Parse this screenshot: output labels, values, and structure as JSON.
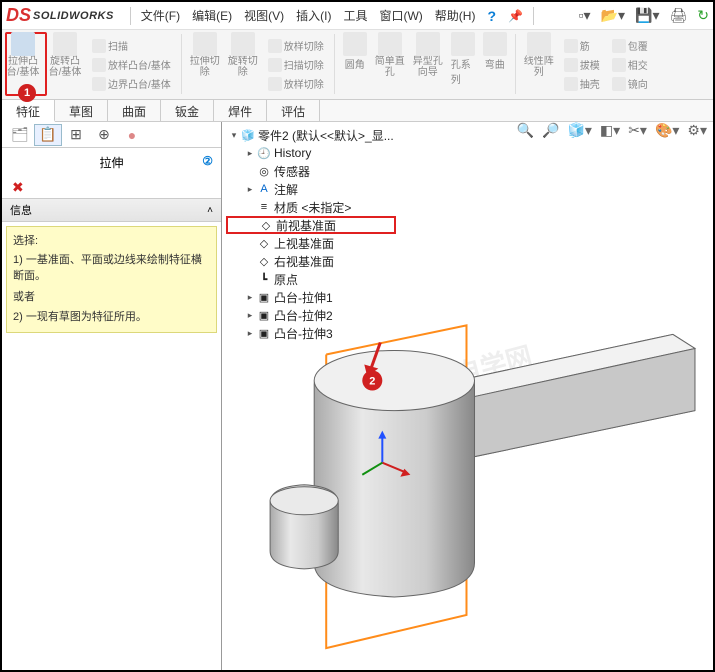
{
  "app": {
    "name": "SOLIDWORKS"
  },
  "menu": {
    "file": "文件(F)",
    "edit": "编辑(E)",
    "view": "视图(V)",
    "insert": "插入(I)",
    "tools": "工具",
    "window": "窗口(W)",
    "help": "帮助(H)"
  },
  "ribbon": {
    "extrude": "拉伸凸台/基体",
    "revolve": "旋转凸台/基体",
    "sweep": "扫描",
    "loft": "放样凸台/基体",
    "boundary": "边界凸台/基体",
    "extrudeCut": "拉伸切除",
    "revolveCut": "旋转切除",
    "loftCut": "放样切除",
    "sweepCut": "扫描切除",
    "boundaryCut": "放样切除",
    "fillet": "圆角",
    "simpleHole": "简单直孔",
    "holeWizard": "异型孔向导",
    "holeSeries": "孔系列",
    "linearPattern": "线性阵列",
    "rib": "筋",
    "draft": "拔模",
    "shell": "抽壳",
    "wrap": "包覆",
    "intersect": "相交",
    "mirror": "镜向"
  },
  "tabs": {
    "feature": "特征",
    "sketch": "草图",
    "surface": "曲面",
    "sheetmetal": "钣金",
    "weldment": "焊件",
    "evaluate": "评估"
  },
  "panel": {
    "title": "拉伸",
    "info_hd": "信息",
    "select_hd": "选择:",
    "hint1": "1) 一基准面、平面或边线来绘制特征横断面。",
    "or": "或者",
    "hint2": "2) 一现有草图为特征所用。"
  },
  "tree": {
    "root": "零件2  (默认<<默认>_显...",
    "history": "History",
    "sensors": "传感器",
    "annotations": "注解",
    "material": "材质 <未指定>",
    "frontPlane": "前视基准面",
    "topPlane": "上视基准面",
    "rightPlane": "右视基准面",
    "origin": "原点",
    "extrude1": "凸台-拉伸1",
    "extrude2": "凸台-拉伸2",
    "extrude3": "凸台-拉伸3"
  },
  "badges": {
    "one": "1",
    "two": "2"
  },
  "watermark": "软件自学网"
}
